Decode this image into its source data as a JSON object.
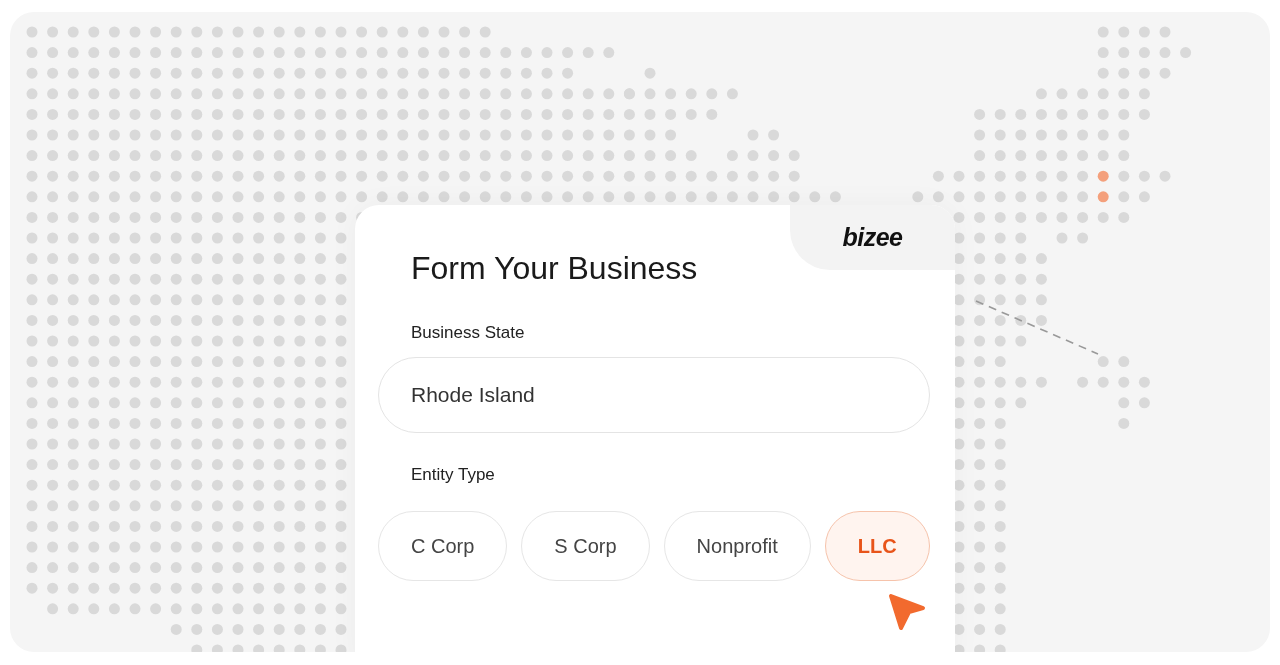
{
  "brand": "bizee",
  "form": {
    "title": "Form Your Business",
    "state_label": "Business State",
    "state_value": "Rhode Island",
    "entity_label": "Entity Type",
    "entity_types": [
      {
        "label": "C Corp",
        "selected": false
      },
      {
        "label": "S Corp",
        "selected": false
      },
      {
        "label": "Nonprofit",
        "selected": false
      },
      {
        "label": "LLC",
        "selected": true
      }
    ]
  }
}
